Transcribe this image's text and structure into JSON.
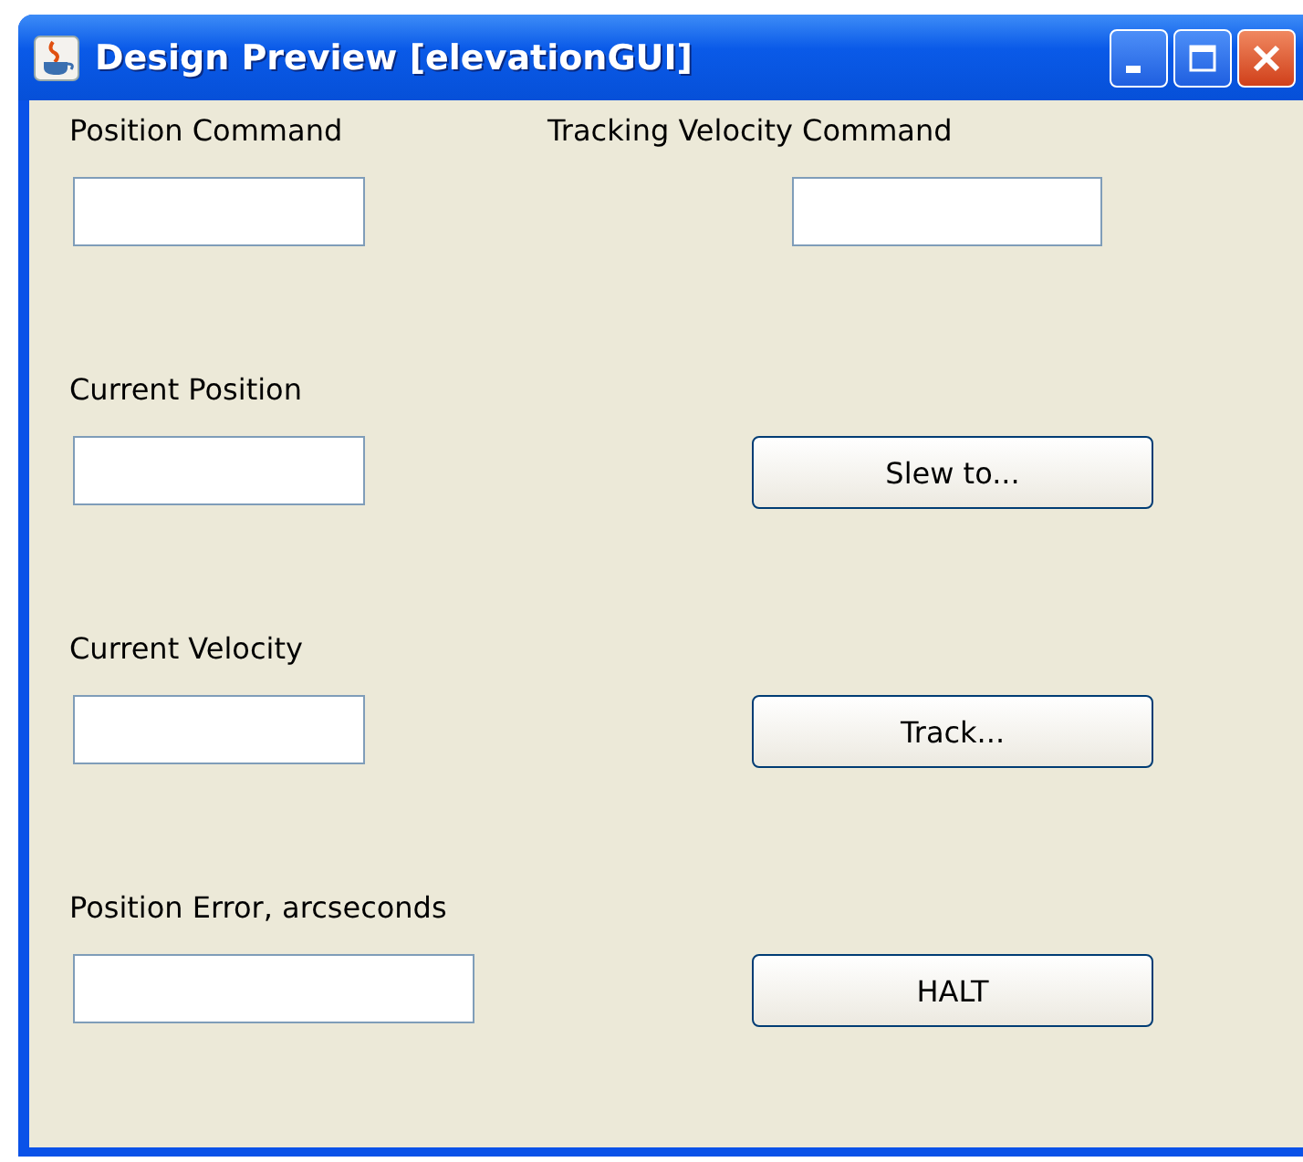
{
  "window": {
    "title": "Design Preview [elevationGUI]"
  },
  "rows": [
    {
      "label": "Position Command",
      "right": {
        "kind": "field",
        "label": "Tracking Velocity Command"
      }
    },
    {
      "label": "Current Position",
      "right": {
        "kind": "button",
        "label": "Slew to..."
      }
    },
    {
      "label": "Current Velocity",
      "right": {
        "kind": "button",
        "label": "Track..."
      }
    },
    {
      "label": "Position Error, arcseconds",
      "right": {
        "kind": "button",
        "label": "HALT"
      }
    }
  ]
}
